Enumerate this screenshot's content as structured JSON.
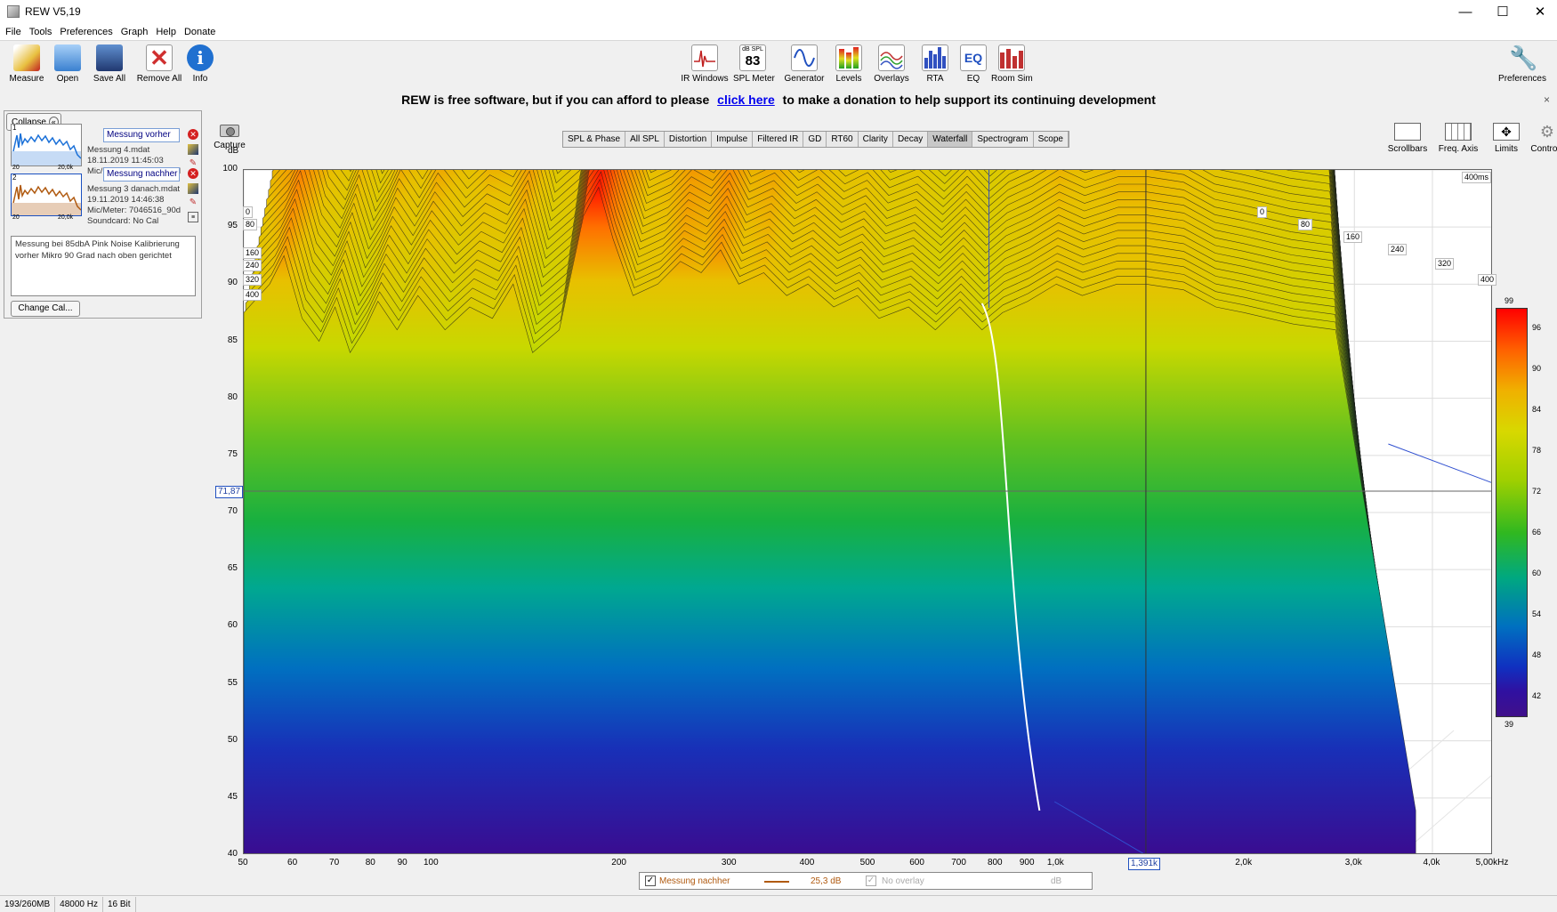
{
  "window": {
    "title": "REW V5,19",
    "controls": [
      "—",
      "☐",
      "✕"
    ]
  },
  "menu": [
    "File",
    "Tools",
    "Preferences",
    "Graph",
    "Help",
    "Donate"
  ],
  "toolbar_left": [
    {
      "label": "Measure",
      "icon": "measure-icon",
      "color": "#e8c040"
    },
    {
      "label": "Open",
      "icon": "folder-icon",
      "color": "#5aa0e0"
    },
    {
      "label": "Save All",
      "icon": "save-icon",
      "color": "#3060b0"
    },
    {
      "label": "Remove All",
      "icon": "remove-icon",
      "color": "#d03030"
    },
    {
      "label": "Info",
      "icon": "info-icon",
      "color": "#2070d0"
    }
  ],
  "toolbar_center": [
    {
      "label": "IR Windows",
      "icon": "ir-windows-icon"
    },
    {
      "label": "SPL Meter",
      "icon": "spl-meter-icon",
      "value": "83",
      "unit": "dB SPL"
    },
    {
      "label": "Generator",
      "icon": "generator-icon"
    },
    {
      "label": "Levels",
      "icon": "levels-icon"
    },
    {
      "label": "Overlays",
      "icon": "overlays-icon"
    },
    {
      "label": "RTA",
      "icon": "rta-icon"
    },
    {
      "label": "EQ",
      "icon": "eq-icon"
    },
    {
      "label": "Room Sim",
      "icon": "room-sim-icon"
    }
  ],
  "toolbar_right": {
    "label": "Preferences",
    "icon": "wrench-icon"
  },
  "donation": {
    "before": "REW is free software, but if you can afford to please",
    "link": "click here",
    "after": "to make a donation to help support its continuing development",
    "close": "×"
  },
  "left_panel": {
    "collapse_label": "Collapse",
    "measurements": [
      {
        "num": "1",
        "name": "Messung vorher",
        "file": "Messung 4.mdat",
        "date": "18.11.2019 11:45:03",
        "mic": "Mic/Meter: 7046516_90d",
        "soundcard": "S",
        "axis_start": "20",
        "axis_end": "20,0k",
        "color": "#1a70d8"
      },
      {
        "num": "2",
        "name": "Messung nachher",
        "file": "Messung 3 danach.mdat",
        "date": "19.11.2019 14:46:38",
        "mic": "Mic/Meter: 7046516_90d",
        "soundcard": "Soundcard: No Cal",
        "axis_start": "20",
        "axis_end": "20,0k",
        "color": "#b05a10"
      }
    ],
    "notes": "Messung bei 85dbA Pink Noise Kalibrierung vorher Mikro 90 Grad nach oben gerichtet",
    "change_cal_label": "Change Cal..."
  },
  "graph": {
    "capture_label": "Capture",
    "tabs": [
      "SPL & Phase",
      "All SPL",
      "Distortion",
      "Impulse",
      "Filtered IR",
      "GD",
      "RT60",
      "Clarity",
      "Decay",
      "Waterfall",
      "Spectrogram",
      "Scope"
    ],
    "active_tab": "Waterfall",
    "right_controls": [
      {
        "label": "Scrollbars",
        "icon": "scrollbars-icon"
      },
      {
        "label": "Freq. Axis",
        "icon": "freq-axis-icon"
      },
      {
        "label": "Limits",
        "icon": "limits-icon"
      },
      {
        "label": "Controls",
        "icon": "gear-icon"
      }
    ],
    "y_unit": "dB",
    "cursor_y": "71,87",
    "cursor_x": "1,391k",
    "time_max": "400ms"
  },
  "chart_data": {
    "type": "waterfall",
    "x_scale": "log",
    "xlim_hz": [
      50,
      5000
    ],
    "ylim_db": [
      40,
      100
    ],
    "y_ticks": [
      40,
      45,
      50,
      55,
      60,
      65,
      70,
      75,
      80,
      85,
      90,
      95,
      100
    ],
    "x_ticks": [
      {
        "hz": 50,
        "label": "50"
      },
      {
        "hz": 60,
        "label": "60"
      },
      {
        "hz": 70,
        "label": "70"
      },
      {
        "hz": 80,
        "label": "80"
      },
      {
        "hz": 90,
        "label": "90"
      },
      {
        "hz": 100,
        "label": "100"
      },
      {
        "hz": 200,
        "label": "200"
      },
      {
        "hz": 300,
        "label": "300"
      },
      {
        "hz": 400,
        "label": "400"
      },
      {
        "hz": 500,
        "label": "500"
      },
      {
        "hz": 600,
        "label": "600"
      },
      {
        "hz": 700,
        "label": "700"
      },
      {
        "hz": 800,
        "label": "800"
      },
      {
        "hz": 900,
        "label": "900"
      },
      {
        "hz": 1000,
        "label": "1,0k"
      },
      {
        "hz": 2000,
        "label": "2,0k"
      },
      {
        "hz": 3000,
        "label": "3,0k"
      },
      {
        "hz": 4000,
        "label": "4,0k"
      },
      {
        "hz": 5000,
        "label": "5,00kHz"
      }
    ],
    "time_ticks_left": [
      "0",
      "80",
      "160",
      "240",
      "320",
      "400"
    ],
    "time_ticks_right": [
      "0",
      "80",
      "160",
      "240",
      "320",
      "400"
    ],
    "color_scale": {
      "max": "99",
      "min": "39",
      "labels": [
        "96",
        "90",
        "84",
        "78",
        "72",
        "66",
        "60",
        "54",
        "48",
        "42"
      ]
    },
    "front_curve_db": [
      [
        50,
        87.5
      ],
      [
        55,
        90
      ],
      [
        58,
        92.5
      ],
      [
        62,
        87
      ],
      [
        66,
        85
      ],
      [
        70,
        88
      ],
      [
        74,
        84
      ],
      [
        78,
        86
      ],
      [
        82,
        88.5
      ],
      [
        88,
        86
      ],
      [
        95,
        89
      ],
      [
        105,
        86
      ],
      [
        115,
        88
      ],
      [
        125,
        87
      ],
      [
        135,
        90
      ],
      [
        145,
        84
      ],
      [
        160,
        86
      ],
      [
        175,
        96
      ],
      [
        185,
        98.5
      ],
      [
        195,
        94
      ],
      [
        210,
        89
      ],
      [
        230,
        90
      ],
      [
        250,
        92
      ],
      [
        270,
        91
      ],
      [
        290,
        93
      ],
      [
        310,
        90
      ],
      [
        340,
        91
      ],
      [
        370,
        89
      ],
      [
        400,
        90
      ],
      [
        440,
        88
      ],
      [
        480,
        89
      ],
      [
        520,
        87
      ],
      [
        580,
        88
      ],
      [
        640,
        86
      ],
      [
        700,
        88
      ],
      [
        760,
        86
      ],
      [
        820,
        87.5
      ],
      [
        900,
        88.5
      ],
      [
        1000,
        90
      ],
      [
        1100,
        89
      ],
      [
        1250,
        90
      ],
      [
        1391,
        90
      ],
      [
        1600,
        89.5
      ],
      [
        1800,
        88
      ],
      [
        2000,
        87.5
      ],
      [
        2400,
        86.5
      ],
      [
        2800,
        86
      ]
    ]
  },
  "legend": {
    "series_name": "Messung nachher",
    "series_value": "25,3 dB",
    "series_color": "#b05a10",
    "overlay_label": "No overlay",
    "overlay_unit": "dB"
  },
  "status": [
    "193/260MB",
    "48000 Hz",
    "16 Bit"
  ]
}
